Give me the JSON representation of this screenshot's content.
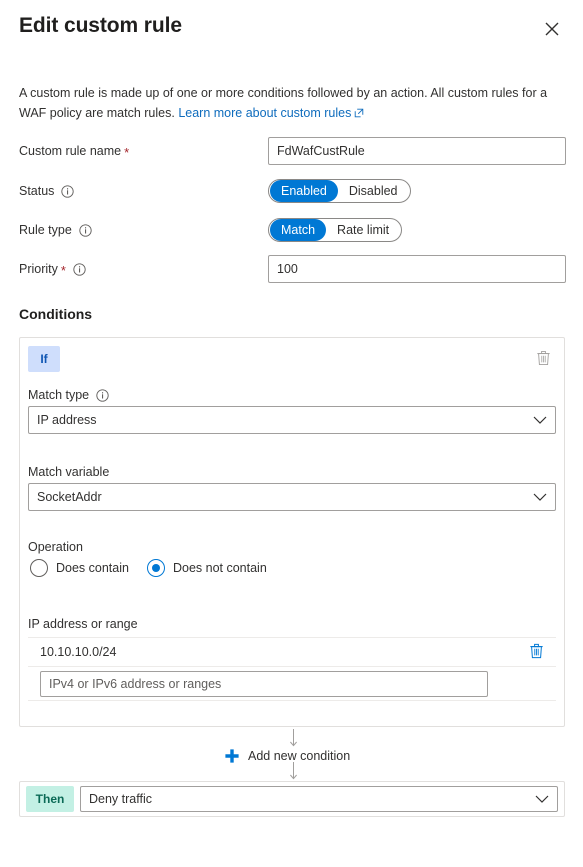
{
  "header": {
    "title": "Edit custom rule",
    "close_label": "Close"
  },
  "description": {
    "text": "A custom rule is made up of one or more conditions followed by an action. All custom rules for a WAF policy are match rules.",
    "link_text": "Learn more about custom rules"
  },
  "form": {
    "rule_name": {
      "label": "Custom rule name",
      "required": "*",
      "value": "FdWafCustRule",
      "placeholder": ""
    },
    "status": {
      "label": "Status",
      "options": [
        "Enabled",
        "Disabled"
      ],
      "selected": "Enabled"
    },
    "rule_type": {
      "label": "Rule type",
      "options": [
        "Match",
        "Rate limit"
      ],
      "selected": "Match"
    },
    "priority": {
      "label": "Priority",
      "required": "*",
      "value": "100",
      "placeholder": ""
    }
  },
  "conditions": {
    "section_title": "Conditions",
    "if_badge": "If",
    "match_type": {
      "label": "Match type",
      "value": "IP address"
    },
    "match_variable": {
      "label": "Match variable",
      "value": "SocketAddr"
    },
    "operation": {
      "label": "Operation",
      "options": [
        "Does contain",
        "Does not contain"
      ],
      "selected": "Does not contain"
    },
    "ip_range": {
      "label": "IP address or range",
      "items": [
        "10.10.10.0/24"
      ],
      "input_placeholder": "IPv4 or IPv6 address or ranges",
      "input_value": ""
    },
    "add_condition_label": "Add new condition"
  },
  "action": {
    "then_badge": "Then",
    "value": "Deny traffic"
  },
  "colors": {
    "accent": "#0078d4",
    "link": "#0f6cbd",
    "required": "#a4262c",
    "if_badge_bg": "#cfdefc",
    "then_badge_bg": "#c3f0e4",
    "border": "#a19f9d",
    "card_border": "#e1dfdd"
  }
}
